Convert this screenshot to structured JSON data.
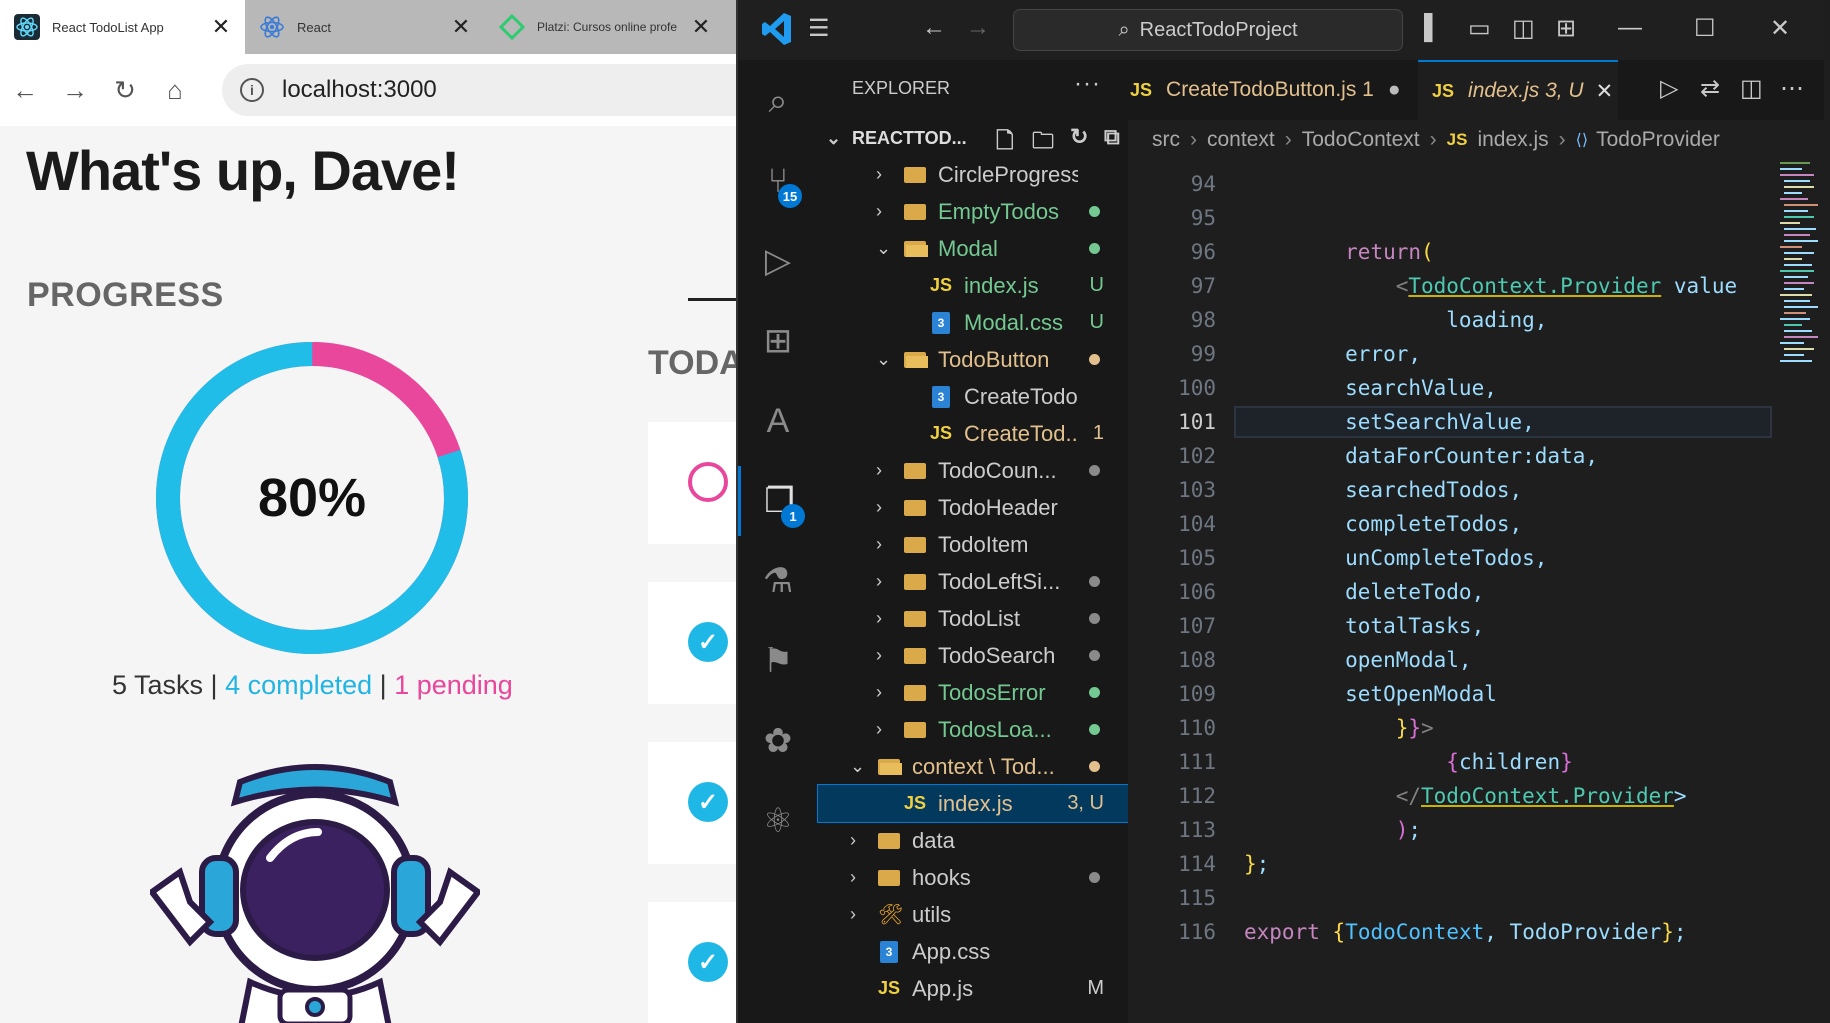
{
  "browser": {
    "tabs": [
      {
        "label": "React TodoList App",
        "close": "✕"
      },
      {
        "label": "React",
        "close": "✕"
      },
      {
        "label": "Platzi: Cursos online profe",
        "close": "✕"
      }
    ],
    "url": "localhost:3000",
    "page": {
      "greeting": "What's up, Dave!",
      "progress_title": "PROGRESS",
      "today_title": "TODAY",
      "progress_percent": "80%",
      "progress_fraction": 0.8,
      "stats": {
        "total": "5 Tasks",
        "sep1": " | ",
        "completed": "4 completed",
        "sep2": " | ",
        "pending": "1 pending"
      },
      "colors": {
        "completed": "#22b5e3",
        "pending": "#e8479b"
      }
    }
  },
  "vscode": {
    "title_search": "ReactTodoProject",
    "explorer_title": "EXPLORER",
    "explorer_more": "···",
    "project_name": "REACTTOD...",
    "activity_badges": {
      "source_control": "15",
      "explorer_item": "1"
    },
    "tree": [
      {
        "label": "CircleProgressBar",
        "type": "folder",
        "indent": 1,
        "expanded": false,
        "status": "",
        "color": "#cccccc"
      },
      {
        "label": "EmptyTodos",
        "type": "folder",
        "indent": 1,
        "expanded": false,
        "status": "dot-green",
        "color": "#73c991"
      },
      {
        "label": "Modal",
        "type": "folder",
        "indent": 1,
        "expanded": true,
        "status": "dot-green",
        "color": "#73c991"
      },
      {
        "label": "index.js",
        "type": "js",
        "indent": 2,
        "status": "U",
        "color": "#73c991"
      },
      {
        "label": "Modal.css",
        "type": "css",
        "indent": 2,
        "status": "U",
        "color": "#73c991"
      },
      {
        "label": "TodoButton",
        "type": "folder",
        "indent": 1,
        "expanded": true,
        "status": "dot-yellow",
        "color": "#e2c08d"
      },
      {
        "label": "CreateTodoBut...",
        "type": "css",
        "indent": 2,
        "status": "",
        "color": "#cccccc"
      },
      {
        "label": "CreateTod...",
        "type": "js",
        "indent": 2,
        "status": "1",
        "color": "#e2c08d"
      },
      {
        "label": "TodoCoun...",
        "type": "folder",
        "indent": 1,
        "expanded": false,
        "status": "dot-gray",
        "color": "#cccccc"
      },
      {
        "label": "TodoHeader",
        "type": "folder",
        "indent": 1,
        "expanded": false,
        "status": "",
        "color": "#cccccc"
      },
      {
        "label": "TodoItem",
        "type": "folder",
        "indent": 1,
        "expanded": false,
        "status": "",
        "color": "#cccccc"
      },
      {
        "label": "TodoLeftSi...",
        "type": "folder",
        "indent": 1,
        "expanded": false,
        "status": "dot-gray",
        "color": "#cccccc"
      },
      {
        "label": "TodoList",
        "type": "folder",
        "indent": 1,
        "expanded": false,
        "status": "dot-gray",
        "color": "#cccccc"
      },
      {
        "label": "TodoSearch",
        "type": "folder",
        "indent": 1,
        "expanded": false,
        "status": "dot-gray",
        "color": "#cccccc"
      },
      {
        "label": "TodosError",
        "type": "folder",
        "indent": 1,
        "expanded": false,
        "status": "dot-green",
        "color": "#73c991"
      },
      {
        "label": "TodosLoa...",
        "type": "folder",
        "indent": 1,
        "expanded": false,
        "status": "dot-green",
        "color": "#73c991"
      },
      {
        "label": "context \\ Tod...",
        "type": "folder",
        "indent": 0,
        "expanded": true,
        "status": "dot-yellow",
        "color": "#e2c08d"
      },
      {
        "label": "index.js",
        "type": "js",
        "indent": 1,
        "status": "3, U",
        "color": "#e2c08d",
        "selected": true
      },
      {
        "label": "data",
        "type": "folder",
        "indent": 0,
        "expanded": false,
        "status": "",
        "color": "#cccccc"
      },
      {
        "label": "hooks",
        "type": "folder",
        "indent": 0,
        "expanded": false,
        "status": "dot-gray",
        "color": "#cccccc"
      },
      {
        "label": "utils",
        "type": "tools",
        "indent": 0,
        "expanded": false,
        "status": "",
        "color": "#cccccc"
      },
      {
        "label": "App.css",
        "type": "css",
        "indent": 0,
        "status": "",
        "color": "#cccccc"
      },
      {
        "label": "App.js",
        "type": "js",
        "indent": 0,
        "status": "M",
        "color": "#cccccc"
      }
    ],
    "editor_tabs": [
      {
        "label": "CreateTodoButton.js 1",
        "prefix": "JS",
        "marker": "●",
        "active": false
      },
      {
        "label": "index.js 3, U",
        "prefix": "JS",
        "marker": "✕",
        "active": true
      }
    ],
    "breadcrumb": [
      "src",
      "context",
      "TodoContext",
      "index.js",
      "TodoProvider"
    ],
    "current_line": "101",
    "code_lines": [
      {
        "n": "94",
        "t": ""
      },
      {
        "n": "95",
        "t": ""
      },
      {
        "n": "96",
        "t": "        return("
      },
      {
        "n": "97",
        "t": "            <TodoContext.Provider value"
      },
      {
        "n": "98",
        "t": "                loading,"
      },
      {
        "n": "99",
        "t": "        error,"
      },
      {
        "n": "100",
        "t": "        searchValue,"
      },
      {
        "n": "101",
        "t": "        setSearchValue,"
      },
      {
        "n": "102",
        "t": "        dataForCounter:data,"
      },
      {
        "n": "103",
        "t": "        searchedTodos,"
      },
      {
        "n": "104",
        "t": "        completeTodos,"
      },
      {
        "n": "105",
        "t": "        unCompleteTodos,"
      },
      {
        "n": "106",
        "t": "        deleteTodo,"
      },
      {
        "n": "107",
        "t": "        totalTasks,"
      },
      {
        "n": "108",
        "t": "        openModal,"
      },
      {
        "n": "109",
        "t": "        setOpenModal"
      },
      {
        "n": "110",
        "t": "            }}>"
      },
      {
        "n": "111",
        "t": "                {children}"
      },
      {
        "n": "112",
        "t": "            </TodoContext.Provider>"
      },
      {
        "n": "113",
        "t": "            );"
      },
      {
        "n": "114",
        "t": "};"
      },
      {
        "n": "115",
        "t": ""
      },
      {
        "n": "116",
        "t": "export {TodoContext, TodoProvider};"
      }
    ]
  }
}
